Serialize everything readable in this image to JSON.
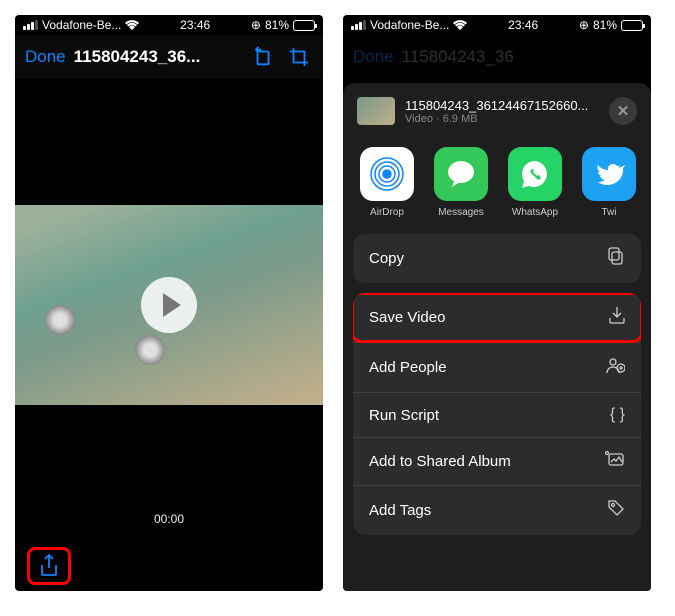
{
  "status": {
    "carrier": "Vodafone-Be...",
    "time": "23:46",
    "battery": "81%"
  },
  "leftPhone": {
    "doneLabel": "Done",
    "title": "115804243_36...",
    "videoTime": "00:00"
  },
  "rightPhone": {
    "dimDone": "Done",
    "dimTitle": "115804243_36",
    "fileName": "115804243_36124467152660...",
    "fileType": "Video",
    "fileSize": "6.9 MB",
    "apps": [
      {
        "label": "AirDrop"
      },
      {
        "label": "Messages"
      },
      {
        "label": "WhatsApp"
      },
      {
        "label": "Twi"
      }
    ],
    "actions": {
      "copy": "Copy",
      "saveVideo": "Save Video",
      "addPeople": "Add People",
      "runScript": "Run Script",
      "addToSharedAlbum": "Add to Shared Album",
      "addTags": "Add Tags"
    }
  }
}
